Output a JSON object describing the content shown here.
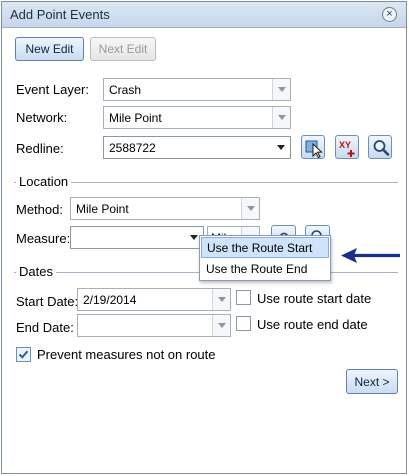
{
  "window": {
    "title": "Add Point Events",
    "close_glyph": "×"
  },
  "tabs": {
    "new_edit": "New Edit",
    "next_edit": "Next Edit"
  },
  "form": {
    "event_layer": {
      "label": "Event Layer:",
      "value": "Crash"
    },
    "network": {
      "label": "Network:",
      "value": "Mile Point"
    },
    "redline": {
      "label": "Redline:",
      "value": "2588722"
    }
  },
  "location": {
    "section_title": "Location",
    "method": {
      "label": "Method:",
      "value": "Mile Point"
    },
    "measure": {
      "label": "Measure:",
      "value": "",
      "units": "Miles"
    },
    "dropdown": {
      "items": [
        "Use the Route Start",
        "Use the Route End"
      ],
      "highlighted_index": 0
    }
  },
  "dates": {
    "section_title": "Dates",
    "start": {
      "label": "Start Date:",
      "value": "2/19/2014",
      "checkbox_label": "Use route start date",
      "checked": false
    },
    "end": {
      "label": "End Date:",
      "value": "",
      "checkbox_label": "Use route end date",
      "checked": false
    }
  },
  "prevent": {
    "label": "Prevent measures not on route",
    "checked": true
  },
  "next_button": "Next >",
  "icons": [
    "select-route-icon",
    "xy-coordinate-icon",
    "zoom-icon",
    "measure-point-icon",
    "measure-zoom-icon",
    "checkmark-icon",
    "blue-arrow-icon"
  ],
  "colors": {
    "accent": "#1a2f8c",
    "highlight": "#cfe3fa",
    "titlebar": "#c6d6ea"
  }
}
